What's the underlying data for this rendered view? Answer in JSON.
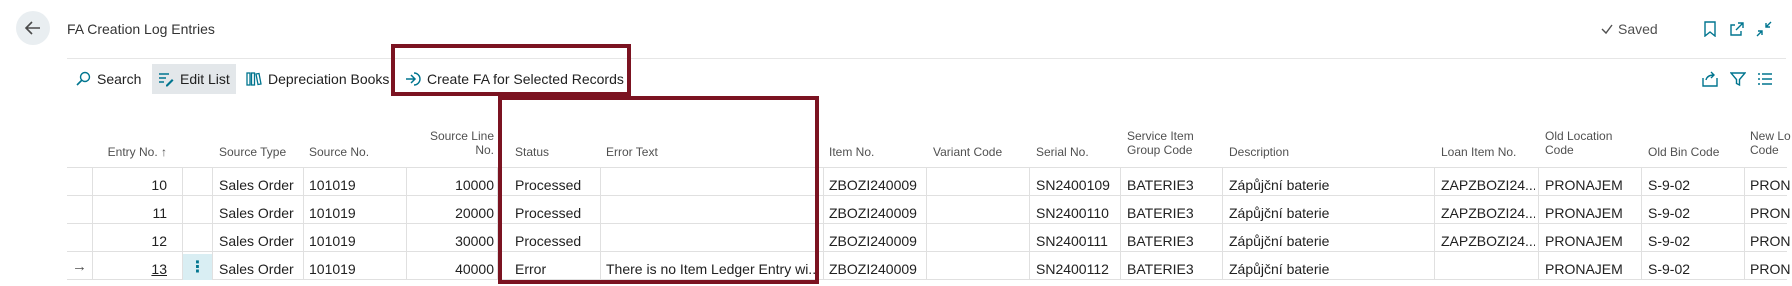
{
  "page": {
    "title": "FA Creation Log Entries",
    "saved_label": "Saved"
  },
  "actions": {
    "search": "Search",
    "edit_list": "Edit List",
    "depreciation_books": "Depreciation Books",
    "create_fa": "Create FA for Selected Records"
  },
  "columns": {
    "entry_no": "Entry No.",
    "sort_indicator": "↑",
    "source_type": "Source Type",
    "source_no": "Source No.",
    "source_line_no_1": "Source Line",
    "source_line_no_2": "No.",
    "status": "Status",
    "error_text": "Error Text",
    "item_no": "Item No.",
    "variant_code": "Variant Code",
    "serial_no": "Serial No.",
    "service_item_group_1": "Service Item",
    "service_item_group_2": "Group Code",
    "description": "Description",
    "loan_item_no": "Loan Item No.",
    "old_location_1": "Old Location",
    "old_location_2": "Code",
    "old_bin_code": "Old Bin Code",
    "new_location_1": "New Lo",
    "new_location_2": "Code"
  },
  "rows": [
    {
      "entry_no": "10",
      "source_type": "Sales Order",
      "source_no": "101019",
      "source_line_no": "10000",
      "status": "Processed",
      "error_text": "",
      "item_no": "ZBOZI240009",
      "variant_code": "",
      "serial_no": "SN2400109",
      "service_item_group": "BATERIE3",
      "description": "Zápůjční baterie",
      "loan_item_no": "ZAPZBOZI24...",
      "old_location": "PRONAJEM",
      "old_bin_code": "S-9-02",
      "new_location": "PRON"
    },
    {
      "entry_no": "11",
      "source_type": "Sales Order",
      "source_no": "101019",
      "source_line_no": "20000",
      "status": "Processed",
      "error_text": "",
      "item_no": "ZBOZI240009",
      "variant_code": "",
      "serial_no": "SN2400110",
      "service_item_group": "BATERIE3",
      "description": "Zápůjční baterie",
      "loan_item_no": "ZAPZBOZI24...",
      "old_location": "PRONAJEM",
      "old_bin_code": "S-9-02",
      "new_location": "PRON"
    },
    {
      "entry_no": "12",
      "source_type": "Sales Order",
      "source_no": "101019",
      "source_line_no": "30000",
      "status": "Processed",
      "error_text": "",
      "item_no": "ZBOZI240009",
      "variant_code": "",
      "serial_no": "SN2400111",
      "service_item_group": "BATERIE3",
      "description": "Zápůjční baterie",
      "loan_item_no": "ZAPZBOZI24...",
      "old_location": "PRONAJEM",
      "old_bin_code": "S-9-02",
      "new_location": "PRON"
    },
    {
      "entry_no": "13",
      "source_type": "Sales Order",
      "source_no": "101019",
      "source_line_no": "40000",
      "status": "Error",
      "error_text": "There is no Item Ledger Entry wi...",
      "item_no": "ZBOZI240009",
      "variant_code": "",
      "serial_no": "SN2400112",
      "service_item_group": "BATERIE3",
      "description": "Zápůjční baterie",
      "loan_item_no": "",
      "old_location": "PRONAJEM",
      "old_bin_code": "S-9-02",
      "new_location": "PRON"
    }
  ],
  "current_row_indicator": "→",
  "row_menu_glyph": "⋮",
  "colors": {
    "highlight_border": "#7b1321",
    "accent": "#00758f",
    "selected_cell": "#d9eef3"
  },
  "icons": [
    "back-arrow-icon",
    "checkmark-icon",
    "bookmark-icon",
    "open-new-window-icon",
    "collapse-icon",
    "search-icon",
    "edit-list-icon",
    "depreciation-books-icon",
    "create-fa-icon",
    "share-icon",
    "filter-icon",
    "list-view-icon"
  ]
}
